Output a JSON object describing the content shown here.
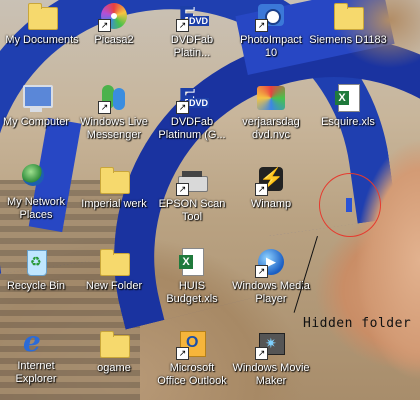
{
  "desktop": {
    "icons": [
      {
        "label": "My Documents",
        "icon": "folder-documents-icon"
      },
      {
        "label": "Picasa2",
        "icon": "picasa-icon"
      },
      {
        "label": "DVDFab\nPlatin...",
        "icon": "dvdfab-icon"
      },
      {
        "label": "PhotoImpact\n10",
        "icon": "camera-icon"
      },
      {
        "label": "Siemens D1183",
        "icon": "folder-icon"
      },
      {
        "label": "My Computer",
        "icon": "computer-icon"
      },
      {
        "label": "Windows Live\nMessenger",
        "icon": "messenger-icon"
      },
      {
        "label": "DVDFab\nPlatinum (G...",
        "icon": "dvdfab-icon"
      },
      {
        "label": "verjaarsdag\ndvd.nvc",
        "icon": "nero-video-icon"
      },
      {
        "label": "Esquire.xls",
        "icon": "excel-icon"
      },
      {
        "label": "My Network\nPlaces",
        "icon": "network-icon"
      },
      {
        "label": "Imperial werk",
        "icon": "folder-icon"
      },
      {
        "label": "EPSON Scan\nTool",
        "icon": "scanner-icon"
      },
      {
        "label": "Winamp",
        "icon": "winamp-icon"
      },
      {
        "label": "Recycle Bin",
        "icon": "recycle-bin-icon"
      },
      {
        "label": "New Folder",
        "icon": "folder-icon"
      },
      {
        "label": "HUIS\nBudget.xls",
        "icon": "excel-icon"
      },
      {
        "label": "Windows Media\nPlayer",
        "icon": "media-player-icon"
      },
      {
        "label": "Internet\nExplorer",
        "icon": "internet-explorer-icon"
      },
      {
        "label": "ogame",
        "icon": "folder-icon"
      },
      {
        "label": "Microsoft\nOffice Outlook",
        "icon": "outlook-icon"
      },
      {
        "label": "Windows Movie\nMaker",
        "icon": "movie-maker-icon"
      }
    ]
  },
  "annotation": {
    "text": "Hidden folder",
    "circle_color": "#e53b2f"
  }
}
